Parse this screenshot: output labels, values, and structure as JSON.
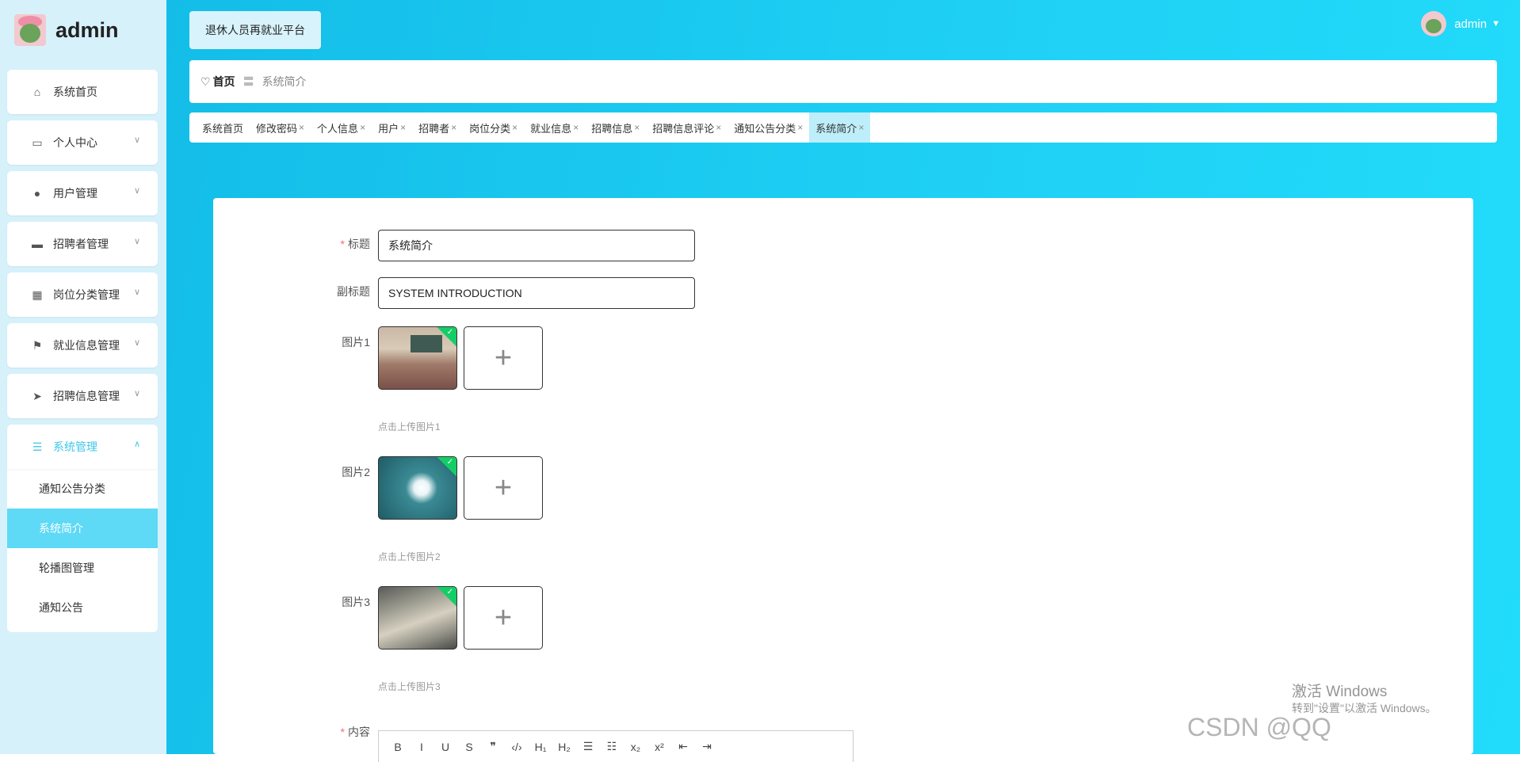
{
  "brand": {
    "name": "admin"
  },
  "sidebar": {
    "items": [
      {
        "label": "系统首页",
        "icon": "home-icon"
      },
      {
        "label": "个人中心",
        "icon": "card-icon"
      },
      {
        "label": "用户管理",
        "icon": "user-icon"
      },
      {
        "label": "招聘者管理",
        "icon": "monitor-icon"
      },
      {
        "label": "岗位分类管理",
        "icon": "grid-icon"
      },
      {
        "label": "就业信息管理",
        "icon": "flag-icon"
      },
      {
        "label": "招聘信息管理",
        "icon": "send-icon"
      },
      {
        "label": "系统管理",
        "icon": "sliders-icon"
      }
    ],
    "subitems": [
      "通知公告分类",
      "系统简介",
      "轮播图管理",
      "通知公告"
    ],
    "active_item": "系统管理",
    "selected_subitem": "系统简介"
  },
  "header": {
    "platform_label": "退休人员再就业平台",
    "user_name": "admin"
  },
  "breadcrumb": {
    "home": "首页",
    "separator": "〓",
    "current": "系统简介"
  },
  "tabs": [
    {
      "label": "系统首页",
      "closable": false
    },
    {
      "label": "修改密码",
      "closable": true
    },
    {
      "label": "个人信息",
      "closable": true
    },
    {
      "label": "用户",
      "closable": true
    },
    {
      "label": "招聘者",
      "closable": true
    },
    {
      "label": "岗位分类",
      "closable": true
    },
    {
      "label": "就业信息",
      "closable": true
    },
    {
      "label": "招聘信息",
      "closable": true
    },
    {
      "label": "招聘信息评论",
      "closable": true
    },
    {
      "label": "通知公告分类",
      "closable": true
    },
    {
      "label": "系统简介",
      "closable": true
    }
  ],
  "tab_close_glyph": "×",
  "form": {
    "title": {
      "label": "标题",
      "required": "*",
      "value": "系统简介"
    },
    "subtitle": {
      "label": "副标题",
      "value": "SYSTEM INTRODUCTION"
    },
    "images": [
      {
        "label": "图片1",
        "hint": "点击上传图片1"
      },
      {
        "label": "图片2",
        "hint": "点击上传图片2"
      },
      {
        "label": "图片3",
        "hint": "点击上传图片3"
      }
    ],
    "content": {
      "label": "内容",
      "required": "*"
    },
    "upload_glyph": "+",
    "success_glyph": "✓"
  },
  "editor_toolbar": [
    "B",
    "I",
    "U",
    "S",
    "❞",
    "‹/›",
    "H₁",
    "H₂",
    "☰",
    "☷",
    "x₂",
    "x²",
    "⇤",
    "⇥"
  ],
  "watermarks": {
    "activate_title": "激活 Windows",
    "activate_sub": "转到\"设置\"以激活 Windows。",
    "csdn": "CSDN @QQ"
  },
  "colors": {
    "accent": "#3fc7e8",
    "selected_bg": "#5ed9f6",
    "sidebar_bg": "#d7f1fb",
    "required": "#f56c6c",
    "upload_success": "#13ce66"
  }
}
